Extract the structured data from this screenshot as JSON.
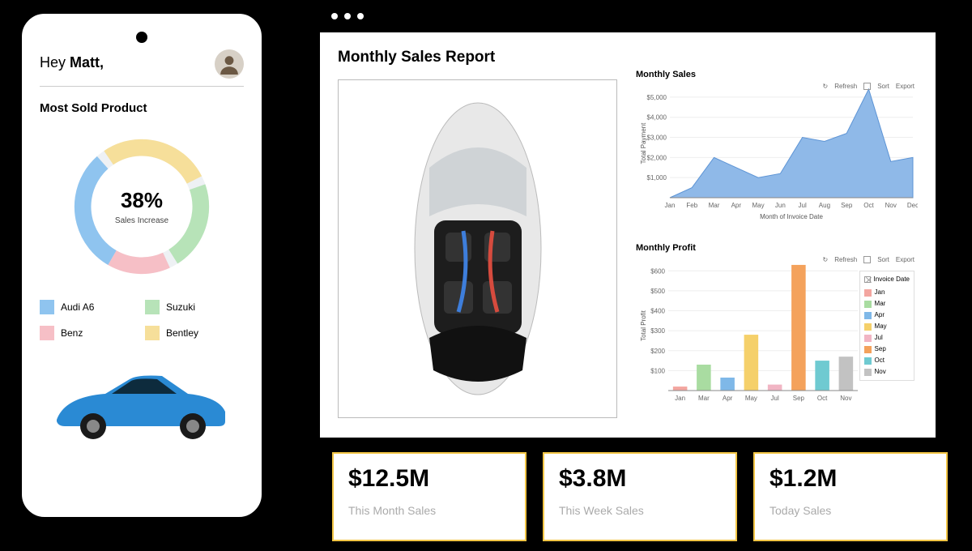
{
  "mobile": {
    "greeting_prefix": "Hey ",
    "greeting_name": "Matt,",
    "section_title": "Most Sold Product",
    "donut_value": "38%",
    "donut_label": "Sales Increase",
    "legend": [
      {
        "label": "Audi A6",
        "color": "#8fc4ef"
      },
      {
        "label": "Suzuki",
        "color": "#b7e3b8"
      },
      {
        "label": "Benz",
        "color": "#f6bfc6"
      },
      {
        "label": "Bentley",
        "color": "#f6df9a"
      }
    ]
  },
  "window": {
    "title": "Monthly Sales Report",
    "toolbar": {
      "refresh": "Refresh",
      "sort": "Sort",
      "export": "Export"
    }
  },
  "chart_data": [
    {
      "type": "area",
      "title": "Monthly Sales",
      "xlabel": "Month of Invoice Date",
      "ylabel": "Total Payment",
      "categories": [
        "Jan",
        "Feb",
        "Mar",
        "Apr",
        "May",
        "Jun",
        "Jul",
        "Aug",
        "Sep",
        "Oct",
        "Nov",
        "Dec"
      ],
      "values": [
        0,
        500,
        2000,
        1500,
        1000,
        1200,
        3000,
        2800,
        3200,
        5400,
        1800,
        2000
      ],
      "ylim": [
        0,
        5400
      ],
      "yticks": [
        1000,
        2000,
        3000,
        4000,
        5000
      ]
    },
    {
      "type": "bar",
      "title": "Monthly Profit",
      "xlabel": "",
      "ylabel": "Total Profit",
      "categories": [
        "Jan",
        "Mar",
        "Apr",
        "May",
        "Jul",
        "Sep",
        "Oct",
        "Nov"
      ],
      "values": [
        20,
        130,
        65,
        280,
        30,
        630,
        150,
        170
      ],
      "colors": [
        "#f3a6a0",
        "#a9dca1",
        "#7fb8e8",
        "#f5d06a",
        "#f1b5c4",
        "#f4a25c",
        "#6fcad1",
        "#c2c2c2"
      ],
      "ylim": [
        0,
        650
      ],
      "yticks": [
        100,
        200,
        300,
        400,
        500,
        600
      ],
      "legend_title": "Invoice Date",
      "legend_items": [
        "Jan",
        "Mar",
        "Apr",
        "May",
        "Jul",
        "Sep",
        "Oct",
        "Nov"
      ]
    }
  ],
  "kpis": [
    {
      "value": "$12.5M",
      "label": "This Month Sales"
    },
    {
      "value": "$3.8M",
      "label": "This Week Sales"
    },
    {
      "value": "$1.2M",
      "label": "Today Sales"
    }
  ]
}
